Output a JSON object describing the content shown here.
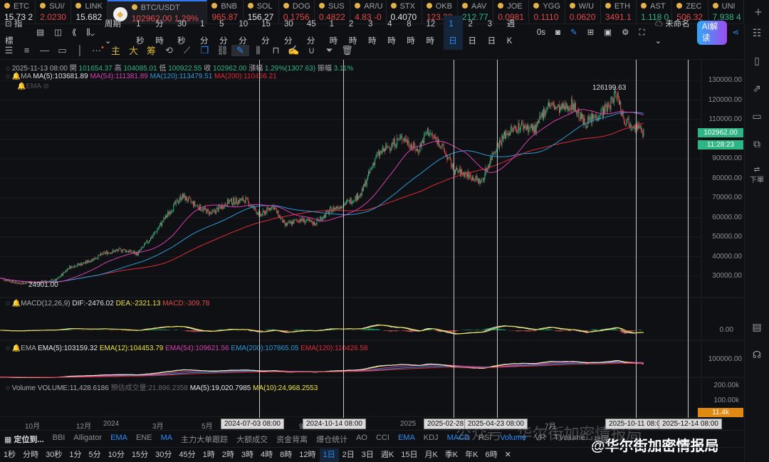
{
  "ticker": [
    {
      "sym": "ETC",
      "price": "15.73 2",
      "color": "white"
    },
    {
      "sym": "SUI/",
      "price": "2.0230",
      "color": "red"
    },
    {
      "sym": "LINK",
      "price": "15.682",
      "color": "white"
    },
    {
      "sym": "BTC/USDT",
      "price": "102962.00",
      "change": "1.29%",
      "color": "red",
      "active": true
    },
    {
      "sym": "BNB",
      "price": "965.87",
      "color": "red"
    },
    {
      "sym": "SOL",
      "price": "156.27",
      "color": "white"
    },
    {
      "sym": "DOG",
      "price": "0.1756",
      "color": "red"
    },
    {
      "sym": "SUS",
      "price": "0.4822",
      "color": "red"
    },
    {
      "sym": "AR/U",
      "price": "4.83 -0",
      "color": "red"
    },
    {
      "sym": "STX",
      "price": "0.4070",
      "color": "white"
    },
    {
      "sym": "OKB",
      "price": "123.30",
      "color": "red"
    },
    {
      "sym": "AAV",
      "price": "212.77",
      "color": "grn"
    },
    {
      "sym": "JOE",
      "price": "0.0981",
      "color": "red"
    },
    {
      "sym": "YGG",
      "price": "0.1110",
      "color": "red"
    },
    {
      "sym": "W/U",
      "price": "0.0620",
      "color": "red"
    },
    {
      "sym": "ETH",
      "price": "3491.1",
      "color": "red"
    },
    {
      "sym": "AST",
      "price": "1.118 0",
      "color": "grn"
    },
    {
      "sym": "ZEC",
      "price": "506.32",
      "color": "red"
    },
    {
      "sym": "UNI",
      "price": "7.938 4",
      "color": "grn"
    }
  ],
  "toolbar": {
    "indicators": "指標",
    "period": "周期",
    "timeframes": [
      "1秒",
      "分時",
      "30秒",
      "1分",
      "5分",
      "10分",
      "15分",
      "30分",
      "45分",
      "1時",
      "2時",
      "3時",
      "4時",
      "8時",
      "12時",
      "1日",
      "2日",
      "3日",
      "週K"
    ],
    "selected": "1日",
    "countdown": "0s",
    "layout_name": "未命名",
    "ai": "AI解读"
  },
  "drawtools": {
    "main": "主",
    "big": "大",
    "chips": "筹"
  },
  "ohlc": {
    "date": "2025-11-13 08:00",
    "open_l": "開",
    "open": "101654.37",
    "high_l": "高",
    "high": "104085.01",
    "low_l": "低",
    "low": "100922.55",
    "close_l": "收",
    "close": "102962.00",
    "chg_l": "漲幅",
    "chg": "1.29%(1307.63)",
    "amp_l": "振幅",
    "amp": "3.11%"
  },
  "ma": {
    "label": "MA",
    "ma5": "MA(5):103681.89",
    "ma54": "MA(54):111381.89",
    "ma120": "MA(120):113479.51",
    "ma200": "MA(200):110456.21"
  },
  "ema_main": {
    "label": "EMA"
  },
  "price_axis": [
    "130000.00",
    "120000.00",
    "110000.00",
    "90000.00",
    "80000.00",
    "70000.00",
    "60000.00",
    "50000.00",
    "40000.00",
    "30000.00"
  ],
  "last_price": "102962.00",
  "countdown_bar": "11:28:23",
  "high_mark": "126199.63",
  "low_mark": "24901.00",
  "macd": {
    "label": "MACD(12,26,9)",
    "dif": "DIF:-2476.02",
    "dea": "DEA:-2321.13",
    "macd": "MACD:-309.78",
    "axis": "0.00"
  },
  "ema": {
    "label": "EMA",
    "e5": "EMA(5):103159.32",
    "e12": "EMA(12):104453.79",
    "e54": "EMA(54):109621.56",
    "e200": "EMA(200):107865.05",
    "e120": "EMA(120):110426.58",
    "axis": "100000.00"
  },
  "volume": {
    "label": "Volume",
    "vol": "VOLUME:11,428.6186",
    "est": "預估成交量:21,896.2358",
    "ma5": "MA(5):19,020.7985",
    "ma10": "MA(10):24,968.2553",
    "axis1": "200.00k",
    "axis2": "100.00k",
    "last": "11.4k"
  },
  "time_axis": [
    "10月",
    "12月",
    "2024",
    "3月",
    "5月",
    "9月",
    "2025",
    "7月"
  ],
  "crosshair_dates": [
    "2024-07-03 08:00",
    "2024-10-14 08:00",
    "2025-02-28 0",
    "2025-04-23 08:00",
    "2025-10-11 08:0",
    "2025-12-14 08:00"
  ],
  "indicators": {
    "locate": "定位到...",
    "items": [
      "BBI",
      "Alligator",
      "EMA",
      "ENE",
      "MA",
      "主力大单跟踪",
      "大额成交",
      "资金背离",
      "爆仓统计",
      "AO",
      "CCI",
      "EMA",
      "KDJ",
      "MACD",
      "RSI",
      "Volume",
      "VR",
      "TVolume",
      "社區"
    ],
    "active": [
      "EMA",
      "MA",
      "MACD",
      "Volume"
    ]
  },
  "bottom_tf": [
    "1秒",
    "分時",
    "30秒",
    "1分",
    "5分",
    "10分",
    "15分",
    "30分",
    "45分",
    "1時",
    "2時",
    "3時",
    "4時",
    "8時",
    "12時",
    "1日",
    "2日",
    "3日",
    "週K",
    "15日",
    "月K",
    "季K",
    "年K",
    "6時"
  ],
  "watermark": {
    "text1": "公众号 · 华尔街加密情报局",
    "text2": "@华尔街加密情报局"
  },
  "sidebar": {
    "order": "下單"
  },
  "chart_data": {
    "type": "candlestick",
    "title": "BTC/USDT 1日",
    "x_unit": "months since 2023-08",
    "ylim": [
      20000,
      135000
    ],
    "price_points": [
      [
        0,
        29000
      ],
      [
        0.7,
        26500
      ],
      [
        1.5,
        26800
      ],
      [
        2.3,
        28000
      ],
      [
        2.8,
        34500
      ],
      [
        3.5,
        37000
      ],
      [
        4.3,
        42000
      ],
      [
        5,
        43500
      ],
      [
        5.6,
        41500
      ],
      [
        6.3,
        52000
      ],
      [
        6.9,
        63000
      ],
      [
        7.4,
        71000
      ],
      [
        8,
        66000
      ],
      [
        8.6,
        62000
      ],
      [
        9.3,
        68000
      ],
      [
        10,
        69000
      ],
      [
        10.6,
        61000
      ],
      [
        11.1,
        66000
      ],
      [
        11.6,
        56000
      ],
      [
        12.2,
        59000
      ],
      [
        12.8,
        57000
      ],
      [
        13.5,
        64000
      ],
      [
        14.2,
        68000
      ],
      [
        14.7,
        72000
      ],
      [
        15.3,
        91000
      ],
      [
        15.9,
        97000
      ],
      [
        16.4,
        101000
      ],
      [
        17,
        94000
      ],
      [
        17.4,
        104000
      ],
      [
        17.9,
        98000
      ],
      [
        18.5,
        84000
      ],
      [
        19,
        82000
      ],
      [
        19.6,
        78000
      ],
      [
        20.1,
        94000
      ],
      [
        20.6,
        103000
      ],
      [
        21.2,
        107000
      ],
      [
        21.8,
        105000
      ],
      [
        22.3,
        118000
      ],
      [
        22.8,
        115000
      ],
      [
        23.3,
        118000
      ],
      [
        23.8,
        108000
      ],
      [
        24.3,
        112000
      ],
      [
        24.8,
        117000
      ],
      [
        25.1,
        124000
      ],
      [
        25.4,
        110000
      ],
      [
        25.8,
        108000
      ],
      [
        26.2,
        102962
      ]
    ]
  }
}
